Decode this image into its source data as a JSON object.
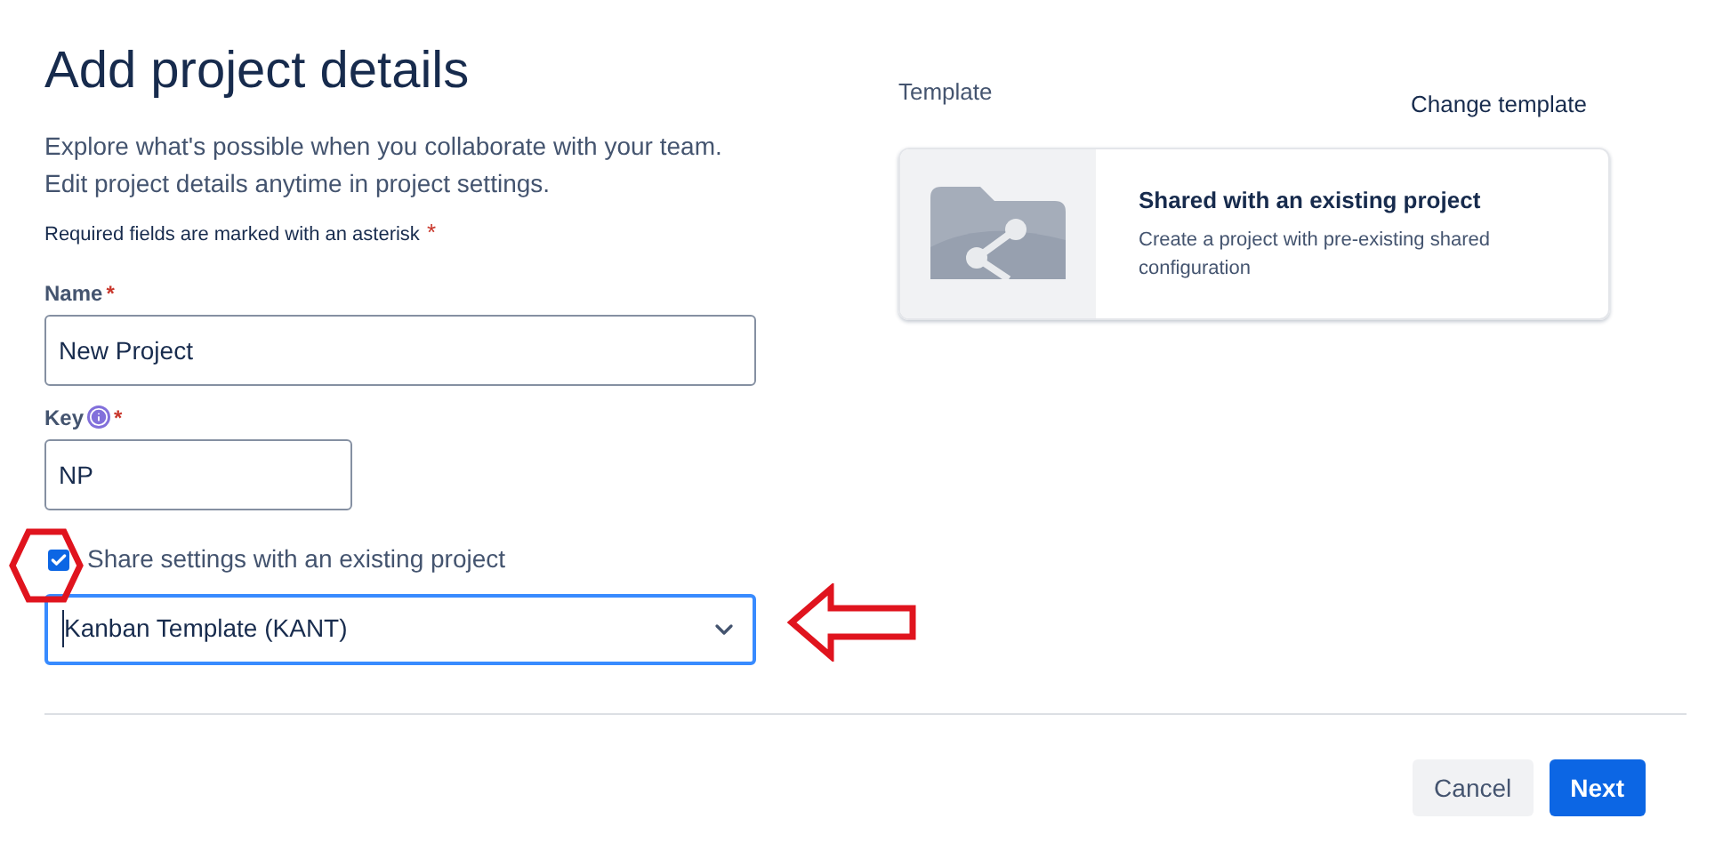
{
  "title": "Add project details",
  "intro": [
    "Explore what's possible when you collaborate with your team.",
    "Edit project details anytime in project settings."
  ],
  "required_note": {
    "text": "Required fields are marked with an asterisk",
    "mark": "*"
  },
  "fields": [
    {
      "label": "Name",
      "required": true,
      "info": false,
      "value": "New Project"
    },
    {
      "label": "Key",
      "required": true,
      "info": true,
      "value": "NP"
    }
  ],
  "share": {
    "label": "Share settings with an existing project",
    "checked": true
  },
  "project_select": {
    "value": "Kanban Template (KANT)",
    "focused": true
  },
  "template": {
    "heading": "Template",
    "change_link": "Change template",
    "card_title": "Shared with an existing project",
    "card_description": "Create a project with pre-existing shared configuration"
  },
  "annotations": [
    {
      "kind": "hexagon",
      "color": "#e0141e"
    },
    {
      "kind": "arrow",
      "color": "#e0141e"
    }
  ],
  "buttons": [
    {
      "label": "Cancel",
      "kind": "subtle"
    },
    {
      "label": "Next",
      "kind": "primary"
    }
  ]
}
